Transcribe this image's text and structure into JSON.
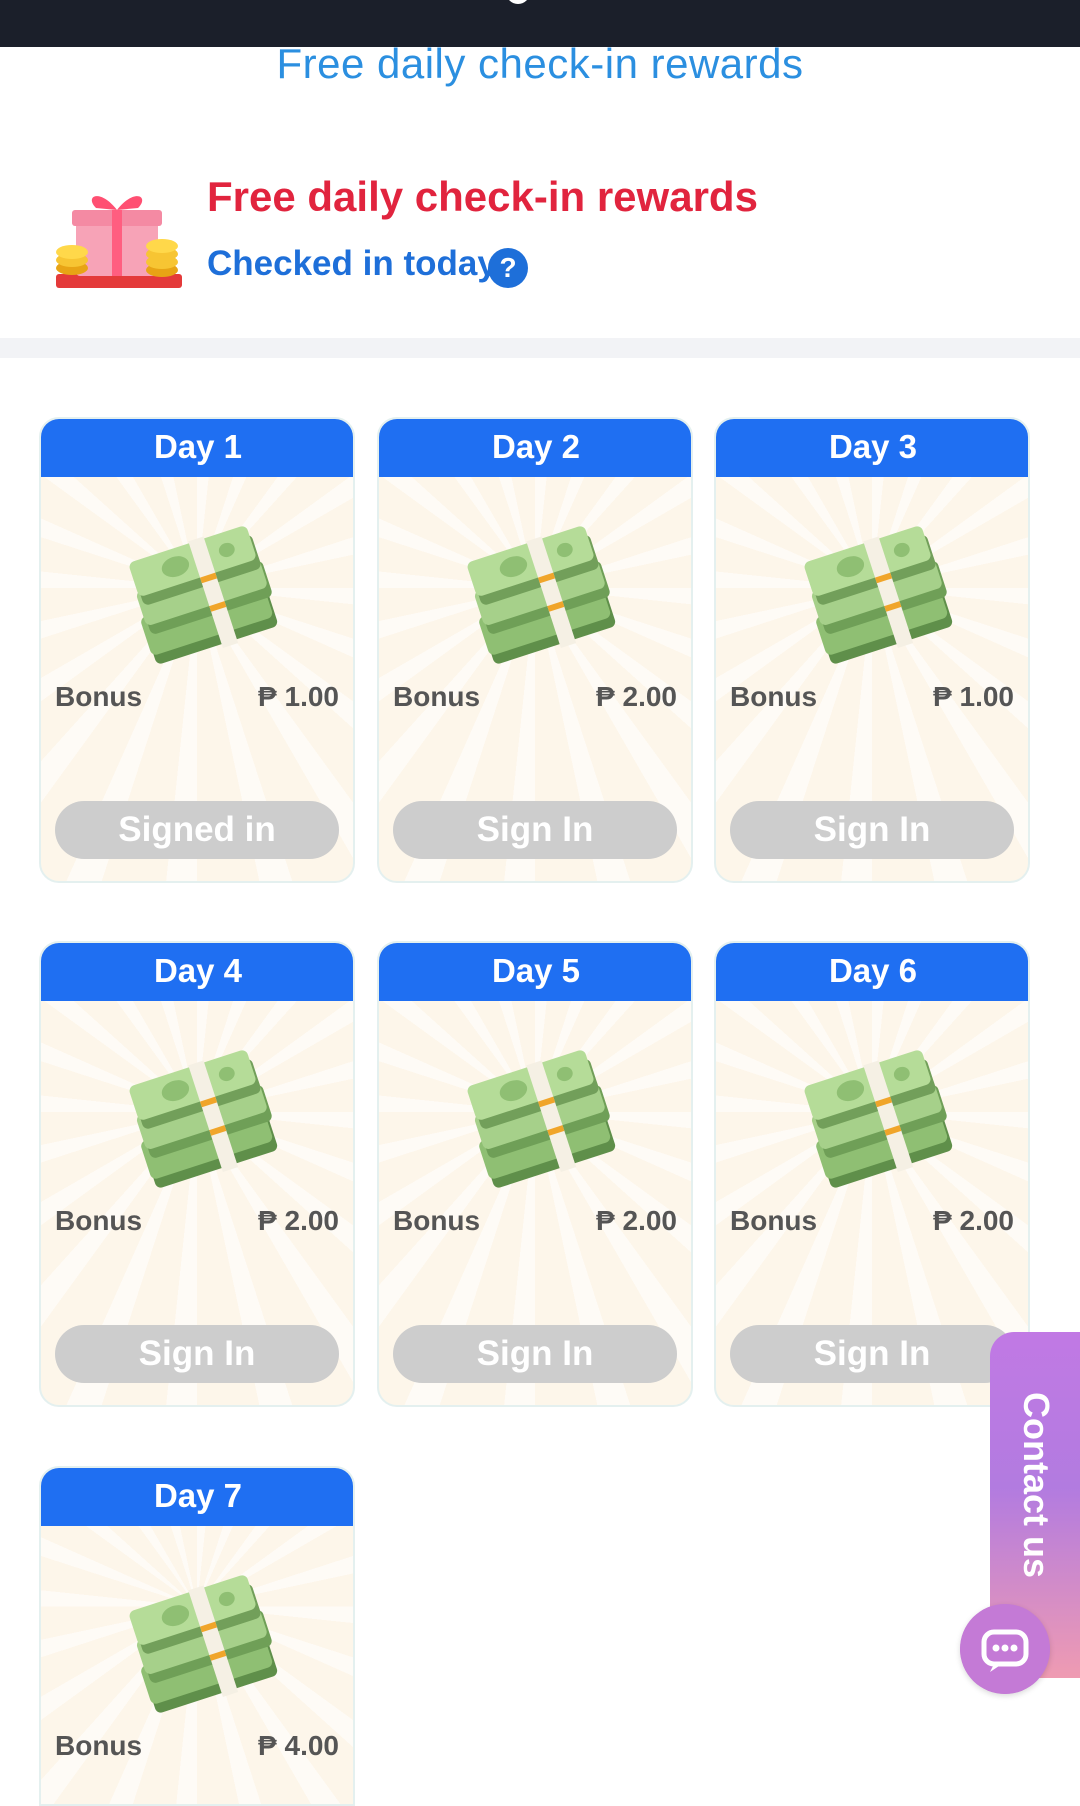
{
  "nav": {
    "title": "Free daily check-in rewards"
  },
  "header": {
    "title": "Free daily check-in rewards",
    "subtitle": "Checked in today",
    "help_glyph": "?"
  },
  "currency_symbol": "₱",
  "days": [
    {
      "label": "Day 1",
      "bonus_label": "Bonus",
      "amount": "₱ 1.00",
      "button": "Signed in"
    },
    {
      "label": "Day 2",
      "bonus_label": "Bonus",
      "amount": "₱ 2.00",
      "button": "Sign In"
    },
    {
      "label": "Day 3",
      "bonus_label": "Bonus",
      "amount": "₱ 1.00",
      "button": "Sign In"
    },
    {
      "label": "Day 4",
      "bonus_label": "Bonus",
      "amount": "₱ 2.00",
      "button": "Sign In"
    },
    {
      "label": "Day 5",
      "bonus_label": "Bonus",
      "amount": "₱ 2.00",
      "button": "Sign In"
    },
    {
      "label": "Day 6",
      "bonus_label": "Bonus",
      "amount": "₱ 2.00",
      "button": "Sign In"
    },
    {
      "label": "Day 7",
      "bonus_label": "Bonus",
      "amount": "₱ 4.00",
      "button": ""
    }
  ],
  "contact": {
    "label": "Contact us"
  },
  "icons": {
    "gift": "gift-coins-icon",
    "money": "cash-stack-icon",
    "chat": "chat-bubble-icon",
    "help": "question-icon"
  },
  "colors": {
    "accent_blue": "#1f6ff2",
    "title_red": "#e1243e",
    "link_blue": "#2b8fe0",
    "button_gray": "#cdcdcd",
    "contact_purple": "#c179e4"
  }
}
